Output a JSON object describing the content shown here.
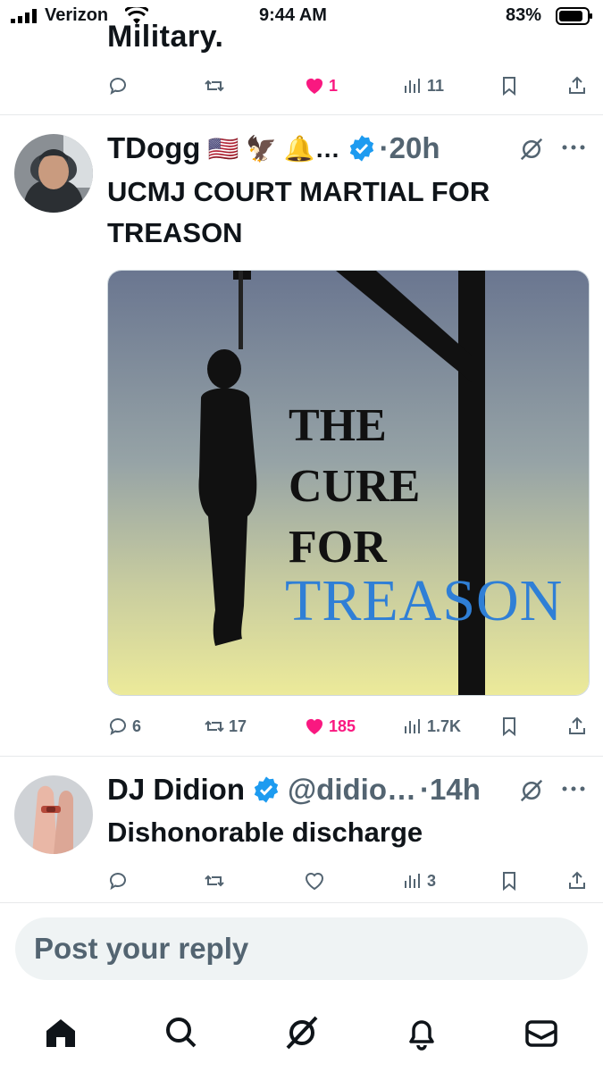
{
  "status_bar": {
    "carrier": "Verizon",
    "time": "9:44 AM",
    "battery": "83%"
  },
  "prev_post": {
    "cut_text": "Military.",
    "stats": {
      "likes": "1",
      "views": "11"
    }
  },
  "post1": {
    "name": "TDogg",
    "emojis": "🇺🇸 🦅 🔔…",
    "time": "·20h",
    "text_line1": "UCMJ COURT MARTIAL FOR",
    "text_line2": "TREASON",
    "image": {
      "line1": "THE",
      "line2": "CURE",
      "line3": "FOR",
      "line4": "TREASON"
    },
    "stats": {
      "replies": "6",
      "reposts": "17",
      "likes": "185",
      "views": "1.7K"
    }
  },
  "post2": {
    "name": "DJ Didion",
    "handle": "@didio…",
    "time": "·14h",
    "text": "Dishonorable discharge",
    "stats": {
      "views": "3"
    }
  },
  "reply": {
    "placeholder": "Post your reply"
  },
  "colors": {
    "accent_blue": "#1d9bf0",
    "like_pink": "#f91880",
    "muted": "#536471"
  }
}
